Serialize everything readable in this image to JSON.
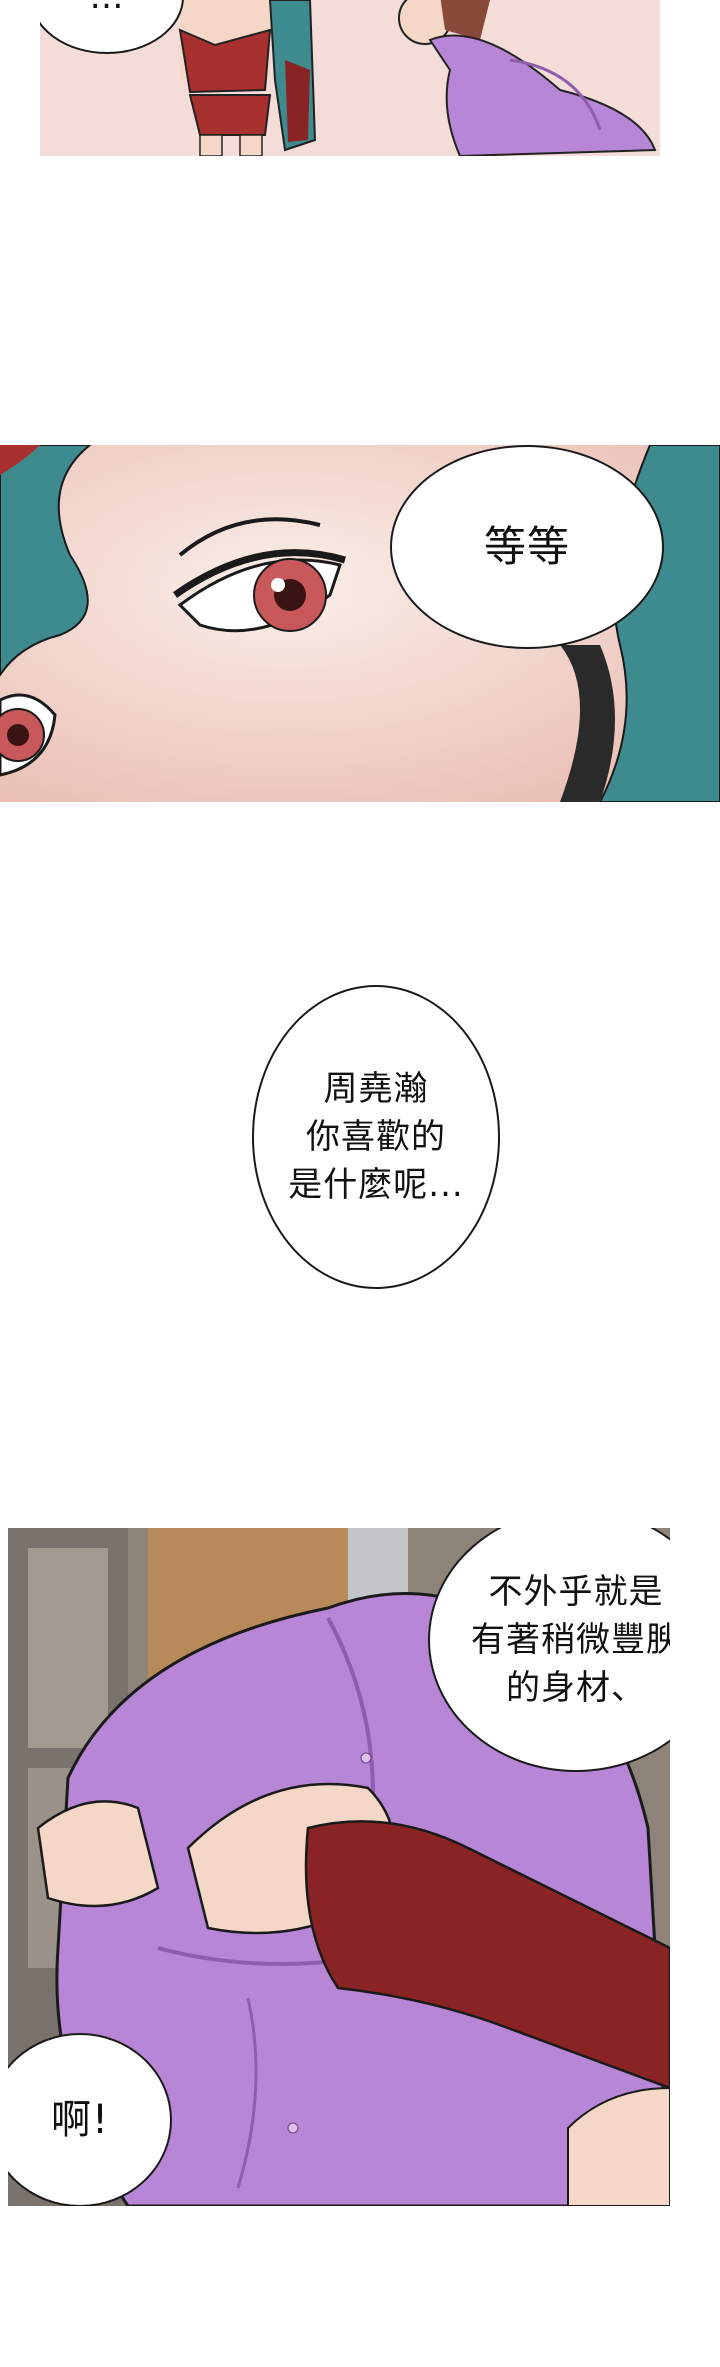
{
  "panels": [
    {
      "id": "panel-1",
      "bubbles": [
        {
          "lines": [
            "…"
          ]
        }
      ]
    },
    {
      "id": "panel-2",
      "bubbles": [
        {
          "lines": [
            "等等"
          ]
        }
      ]
    },
    {
      "id": "panel-3",
      "bubbles": [
        {
          "lines": [
            "周堯瀚",
            "你喜歡的",
            "是什麼呢..."
          ]
        }
      ]
    },
    {
      "id": "panel-4",
      "bubbles": [
        {
          "lines": [
            "不外乎就是",
            "有著稍微豐腴",
            "的身材、"
          ]
        },
        {
          "lines": [
            "啊!"
          ]
        }
      ]
    }
  ],
  "colors": {
    "bg_pink": "#f4dcd8",
    "hair_teal": "#3d8a8f",
    "uniform_purple": "#b886d6",
    "uniform_purple_dark": "#8f5cae",
    "swimsuit_red": "#a8302f",
    "glove_red": "#8a2424",
    "skin": "#f5d7c8",
    "eye_red": "#c8585a",
    "city_bg": "#8e8378"
  }
}
